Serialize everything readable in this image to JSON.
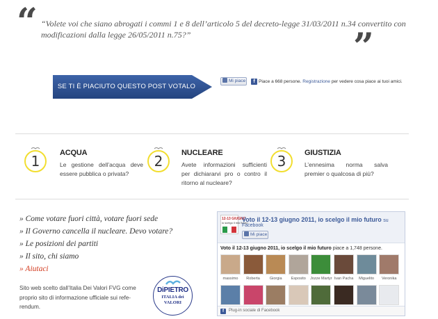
{
  "quote": {
    "open_mark": "“",
    "close_mark": "”",
    "line1": "“Volete voi che siano abrogati i commi 1 e 8 dell’articolo 5 del decreto-legge 31/03/2011 n.34 convertito con",
    "line2": "modificazioni dalla legge 26/05/2011 n.75?”"
  },
  "cta": {
    "label": "SE TI È PIACIUTO QUESTO POST VOTALO QUI",
    "color": "#2f5496"
  },
  "fb_like": {
    "button_label": "Mi piace",
    "text_before": "Piace a 668 persone.",
    "link": "Registrazione",
    "text_after": "per vedere cosa piace ai tuoi amici."
  },
  "topics": [
    {
      "number": "1",
      "title": "ACQUA",
      "desc_lines": [
        "Le gestione dell’acqua deve",
        "essere pubblica o privata?"
      ]
    },
    {
      "number": "2",
      "title": "NUCLEARE",
      "desc_lines": [
        "Avete informazioni sufficienti",
        "per dichiararvi pro o contro il",
        "ritorno al nucleare?"
      ]
    },
    {
      "number": "3",
      "title": "GIUSTIZIA",
      "desc_lines": [
        "L’ennesima norma salva",
        "premier o qualcosa di più?"
      ]
    }
  ],
  "links": [
    {
      "text": "» Come votare fuori città, votare fuori sede"
    },
    {
      "text": "» Il Governo cancella il nucleare. Devo votare?"
    },
    {
      "text": "» Le posizioni dei partiti"
    },
    {
      "text": "» Il sito, chi siamo"
    },
    {
      "text": "» Aiutaci",
      "accent": "#d23a1e"
    }
  ],
  "site_info": {
    "lines": [
      "Sito web scelto dall’Italia Dei Valori FVG come",
      "proprio sito di informazione ufficiale sui refe-",
      "rendum."
    ]
  },
  "logo": {
    "line1": "DiPIETRO",
    "line2": "ITALIA dei",
    "line3": "VALORI"
  },
  "fb_widget": {
    "thumb_title": "12-13 GIUGNO",
    "thumb_sub": "io scelgo il mio futuro",
    "title": "Voto il 12-13 giugno 2011, io scelgo il mio futuro",
    "title_suffix": "su",
    "subtitle": "Facebook",
    "button_label": "Mi piace",
    "count_bold": "Voto il 12-13 giugno 2011, io scelgo il mio futuro",
    "count_rest": "piace a 1,748 persone.",
    "fans_row1": [
      {
        "name": "massimo",
        "color": "#c9a98a"
      },
      {
        "name": "Roberta",
        "color": "#8a5a3a"
      },
      {
        "name": "Giorgia",
        "color": "#b98a55"
      },
      {
        "name": "Esposito",
        "color": "#b0a59a"
      },
      {
        "name": "Jozze Martyr",
        "color": "#3c8d3a"
      },
      {
        "name": "Ivan Pacha",
        "color": "#6a4a3a"
      },
      {
        "name": "Miguelito",
        "color": "#6e8b9a"
      },
      {
        "name": "Veronika",
        "color": "#a07a6a"
      }
    ],
    "fans_row2": [
      {
        "color": "#5b7fa8"
      },
      {
        "color": "#c9456a"
      },
      {
        "color": "#9b7d63"
      },
      {
        "color": "#d9c8b8"
      },
      {
        "color": "#4f6b3a"
      },
      {
        "color": "#3a2a22"
      },
      {
        "color": "#7a8a9a"
      },
      {
        "color": "#e8eaee"
      }
    ],
    "footer": "Plug-in sociale di Facebook"
  },
  "colors": {
    "facebook_blue": "#3b5998",
    "circle_yellow": "#f2de2f",
    "accent_red": "#d23a1e"
  }
}
